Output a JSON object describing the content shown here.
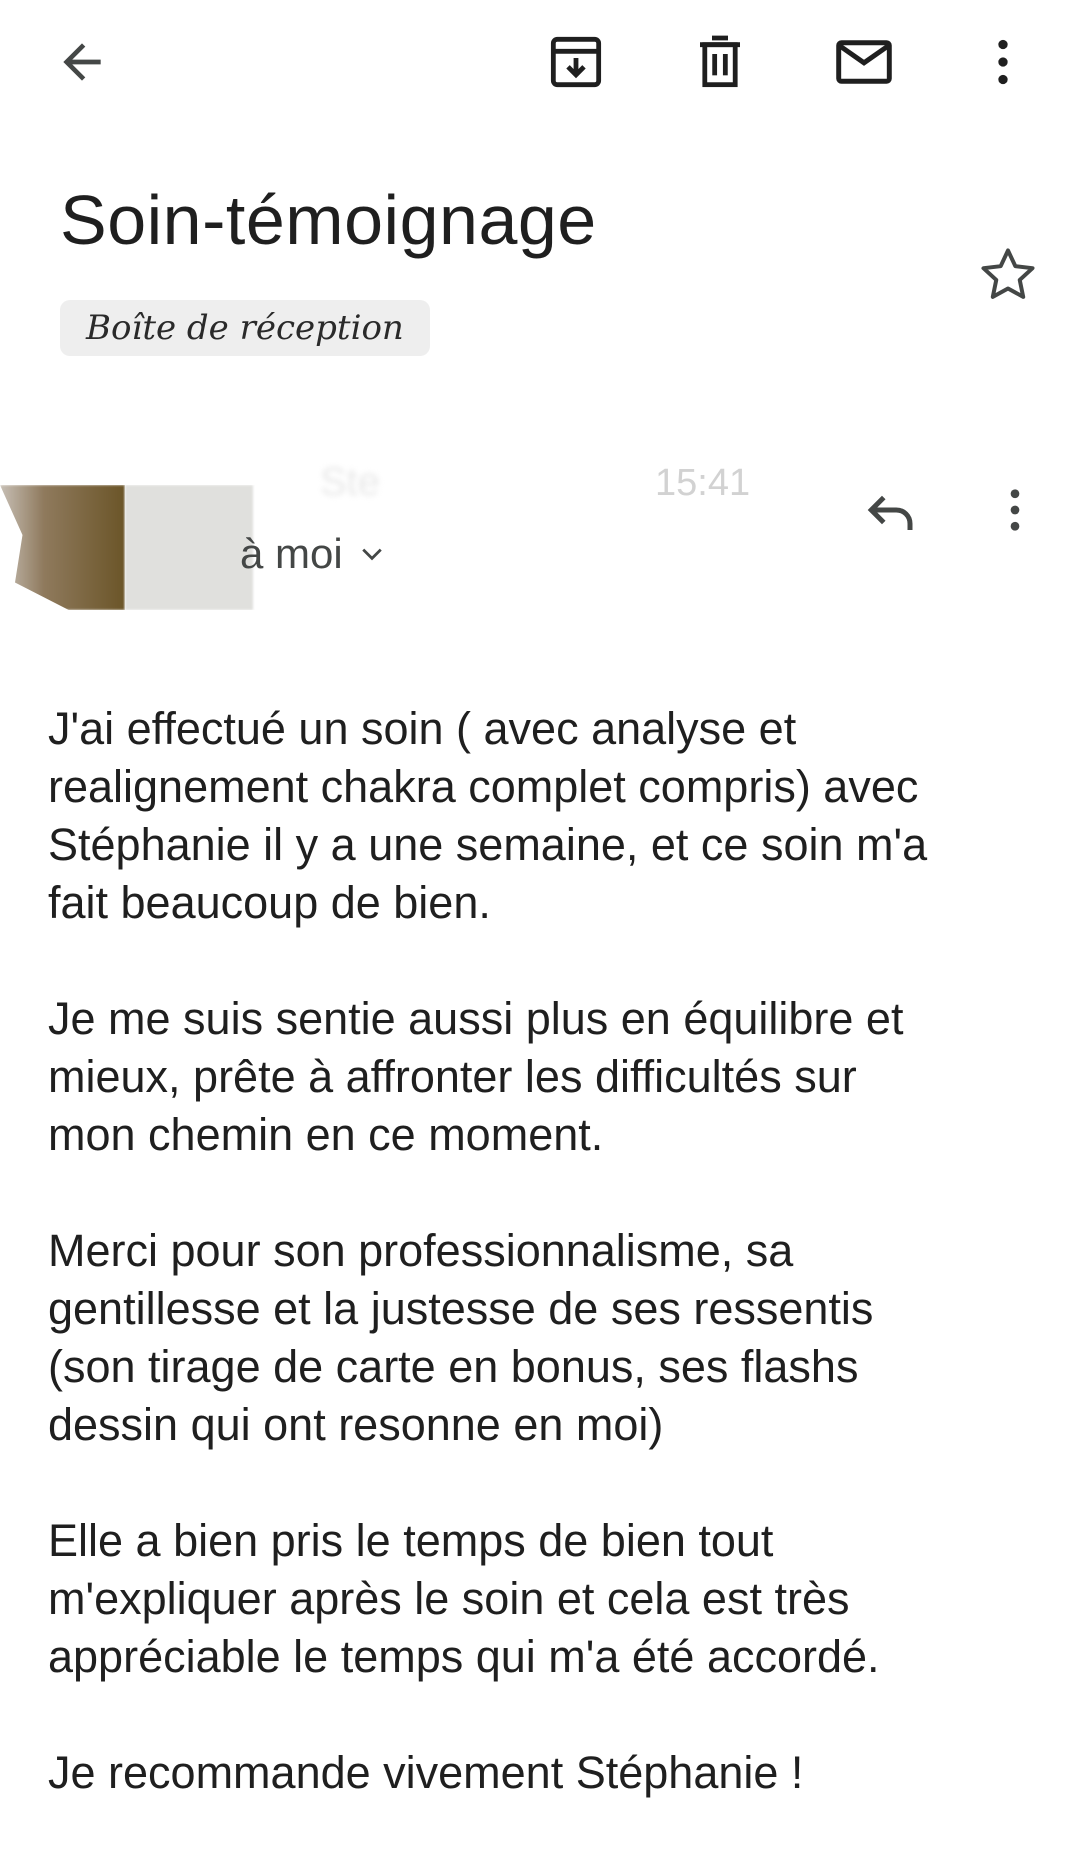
{
  "toolbar": {
    "back_icon": "arrow-left-icon",
    "archive_icon": "archive-icon",
    "delete_icon": "trash-icon",
    "mark_unread_icon": "envelope-icon",
    "more_icon": "more-vertical-icon"
  },
  "email": {
    "subject": "Soin-témoignage",
    "label": "Boîte de réception",
    "starred": false,
    "sender_name": "Ste",
    "time": "15:41",
    "recipient": "à moi",
    "body": [
      "J'ai effectué un soin ( avec analyse et\nrealignement chakra complet compris) avec\nStéphanie il y a une semaine, et ce soin m'a\nfait beaucoup de bien.",
      "Je me suis sentie aussi plus en équilibre et\nmieux, prête à affronter les difficultés sur\nmon chemin en ce moment.",
      "Merci pour son professionnalisme, sa\ngentillesse et la justesse de ses ressentis\n(son tirage de carte en bonus, ses flashs\ndessin qui ont resonne en moi)",
      "Elle a bien  pris le temps de bien tout\nm'expliquer après le soin et cela est très\nappréciable le temps qui m'a été accordé.",
      "Je recommande vivement Stéphanie !"
    ]
  },
  "colors": {
    "text": "#1f1f1f",
    "secondary_text": "#444746",
    "chip_bg": "#eeeeee",
    "background": "#ffffff"
  }
}
